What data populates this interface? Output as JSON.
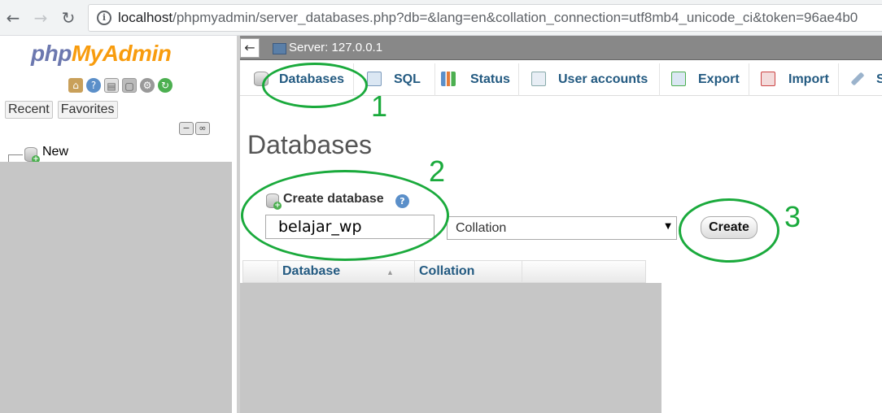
{
  "browser": {
    "url_host": "localhost",
    "url_path": "/phpmyadmin/server_databases.php?db=&lang=en&collation_connection=utf8mb4_unicode_ci&token=96ae4b0"
  },
  "sidebar": {
    "logo_php": "php",
    "logo_my": "My",
    "logo_admin": "Admin",
    "tabs": [
      "Recent",
      "Favorites"
    ],
    "tree_new_label": "New"
  },
  "server_bar": {
    "label": "Server: 127.0.0.1"
  },
  "tabs": [
    {
      "label": "Databases"
    },
    {
      "label": "SQL"
    },
    {
      "label": "Status"
    },
    {
      "label": "User accounts"
    },
    {
      "label": "Export"
    },
    {
      "label": "Import"
    },
    {
      "label": "S"
    }
  ],
  "main": {
    "title": "Databases",
    "create_db_label": "Create database",
    "db_name_value": "belajar_wp",
    "collation_selected": "Collation",
    "create_button": "Create",
    "table_headers": [
      "Database",
      "Collation"
    ]
  },
  "annotations": [
    "1",
    "2",
    "3"
  ],
  "colors": {
    "annotation": "#1aaa3c",
    "tab_text": "#235a81",
    "server_bar": "#888888"
  }
}
